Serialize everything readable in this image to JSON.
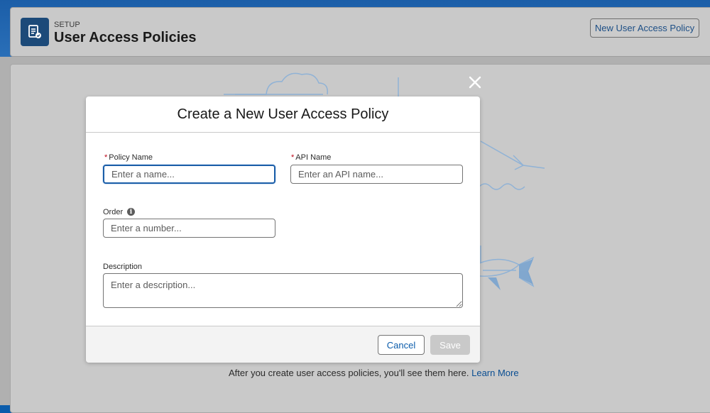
{
  "header": {
    "eyebrow": "SETUP",
    "title": "User Access Policies",
    "new_button_label": "New User Access Policy"
  },
  "empty_state": {
    "message": "After you create user access policies, you'll see them here.",
    "link_label": "Learn More"
  },
  "modal": {
    "title": "Create a New User Access Policy",
    "required_marker": "*",
    "fields": {
      "policy_name": {
        "label": "Policy Name",
        "placeholder": "Enter a name...",
        "value": ""
      },
      "api_name": {
        "label": "API Name",
        "placeholder": "Enter an API name...",
        "value": ""
      },
      "order": {
        "label": "Order",
        "placeholder": "Enter a number...",
        "value": ""
      },
      "description": {
        "label": "Description",
        "placeholder": "Enter a description...",
        "value": ""
      }
    },
    "info_glyph": "i",
    "cancel_label": "Cancel",
    "save_label": "Save"
  },
  "icons": {
    "header": "policy-document-icon",
    "close": "close-icon",
    "info": "info-icon"
  },
  "colors": {
    "brand": "#1b5ea8",
    "link": "#0b5cab",
    "required": "#ba0517"
  }
}
